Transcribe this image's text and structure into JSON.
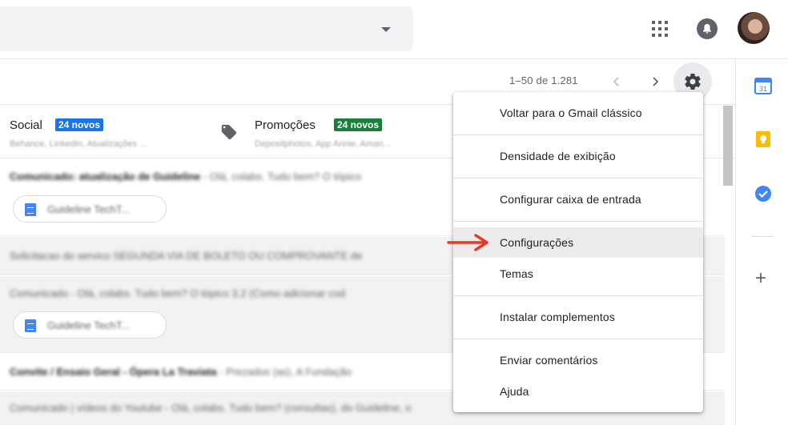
{
  "header": {
    "apps_icon": "apps-grid-icon",
    "notification_icon": "bell-icon",
    "avatar_icon": "account-avatar"
  },
  "toolbar": {
    "pagination": "1–50 de 1.281",
    "settings_icon": "gear-icon"
  },
  "tabs": [
    {
      "label": "Social",
      "badge": "24 novos",
      "badge_color": "#1a73e8",
      "subtitle": "Behance, LinkedIn, Atualizações ..."
    },
    {
      "label": "Promoções",
      "badge": "24 novos",
      "badge_color": "#188038",
      "subtitle": "Depositphotos, App Annie, Aman..."
    }
  ],
  "settings_menu": {
    "items": [
      "Voltar para o Gmail clássico",
      "Densidade de exibição",
      "Configurar caixa de entrada",
      "Configurações",
      "Temas",
      "Instalar complementos",
      "Enviar comentários",
      "Ajuda"
    ],
    "highlighted": "Configurações"
  },
  "emails": [
    {
      "sender": "Comunicado: atualização de Guideline",
      "snippet": " - Olá, colabs. Tudo bem? O tópico",
      "attachment": "Guideline TechT..."
    },
    {
      "sender": "",
      "snippet": "Solicitacao do servico SEGUNDA VIA DE BOLETO OU COMPROVANTE de",
      "attachment": ""
    },
    {
      "sender": "",
      "snippet": "Comunicado - Olá, colabs. Tudo bem? O tópico 3.2 (Como adicionar cod",
      "attachment": "Guideline TechT..."
    },
    {
      "sender": "Convite / Ensaio Geral - Ópera La Traviata",
      "snippet": " - Prezados (as), A Fundação",
      "attachment": ""
    },
    {
      "sender": "",
      "snippet": "Comunicado | vídeos do Youtube - Olá, colabs. Tudo bem? (consultas), do Guideline, o",
      "attachment": ""
    }
  ],
  "side_panel": {
    "calendar_label": "31",
    "icons": [
      "calendar-icon",
      "keep-icon",
      "tasks-icon",
      "add-icon"
    ],
    "plus": "+"
  },
  "colors": {
    "accent_blue": "#1a73e8",
    "promo_green": "#188038",
    "annotation_arrow": "#e53b24"
  }
}
